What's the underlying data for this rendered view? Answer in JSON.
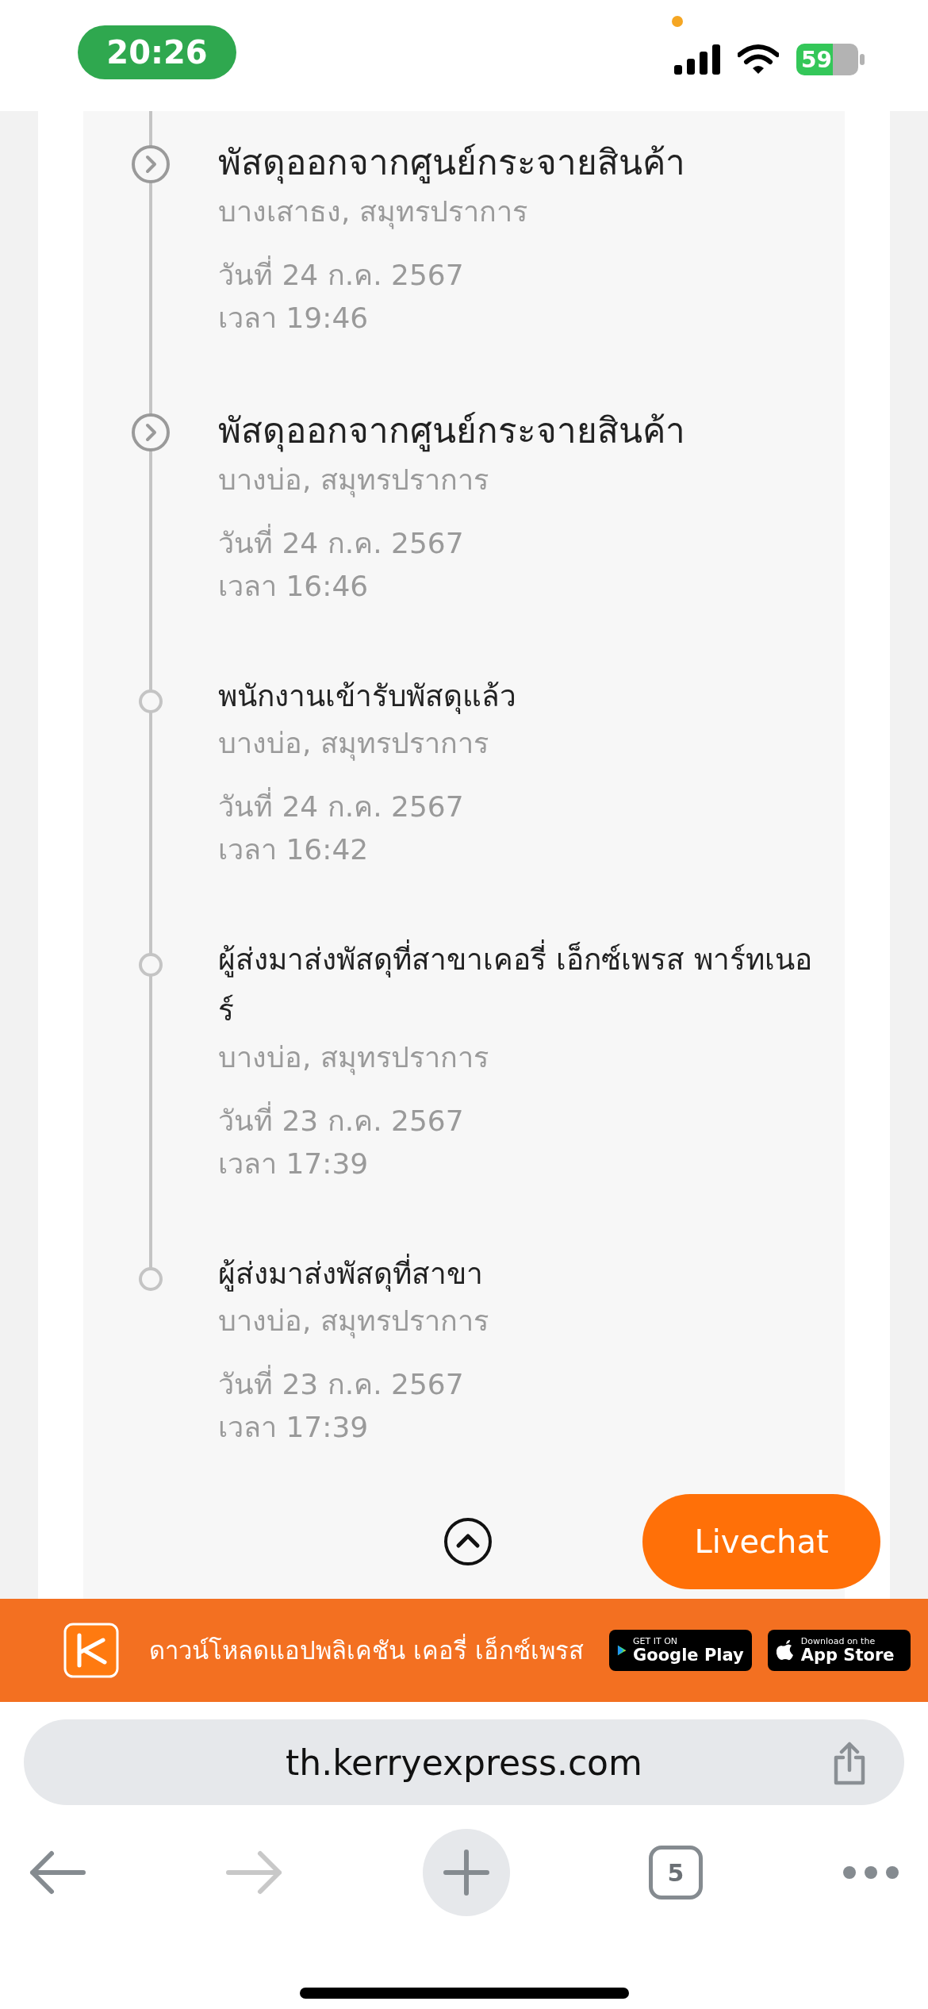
{
  "status_bar": {
    "time": "20:26",
    "battery": "59"
  },
  "events": [
    {
      "kind": "major",
      "title": "พัสดุออกจากศูนย์กระจายสินค้า",
      "location": "บางเสาธง, สมุทรปราการ",
      "date": "วันที่ 24 ก.ค. 2567",
      "time": "เวลา 19:46"
    },
    {
      "kind": "major",
      "title": "พัสดุออกจากศูนย์กระจายสินค้า",
      "location": "บางบ่อ, สมุทรปราการ",
      "date": "วันที่ 24 ก.ค. 2567",
      "time": "เวลา 16:46"
    },
    {
      "kind": "minor",
      "title": "พนักงานเข้ารับพัสดุแล้ว",
      "location": "บางบ่อ, สมุทรปราการ",
      "date": "วันที่ 24 ก.ค. 2567",
      "time": "เวลา 16:42"
    },
    {
      "kind": "minor",
      "title": "ผู้ส่งมาส่งพัสดุที่สาขาเคอรี่ เอ็กซ์เพรส พาร์ทเนอร์",
      "location": "บางบ่อ, สมุทรปราการ",
      "date": "วันที่ 23 ก.ค. 2567",
      "time": "เวลา 17:39"
    },
    {
      "kind": "minor",
      "title": "ผู้ส่งมาส่งพัสดุที่สาขา",
      "location": "บางบ่อ, สมุทรปราการ",
      "date": "วันที่ 23 ก.ค. 2567",
      "time": "เวลา 17:39"
    }
  ],
  "livechat": "Livechat",
  "app_banner": {
    "text": "ดาวน์โหลดแอปพลิเคชัน เคอรี่ เอ็กซ์เพรส",
    "google_play": {
      "small": "GET IT ON",
      "large": "Google Play"
    },
    "app_store": {
      "small": "Download on the",
      "large": "App Store"
    }
  },
  "browser": {
    "url": "th.kerryexpress.com",
    "tab_count": "5",
    "back_disabled": false,
    "forward_disabled": true
  }
}
